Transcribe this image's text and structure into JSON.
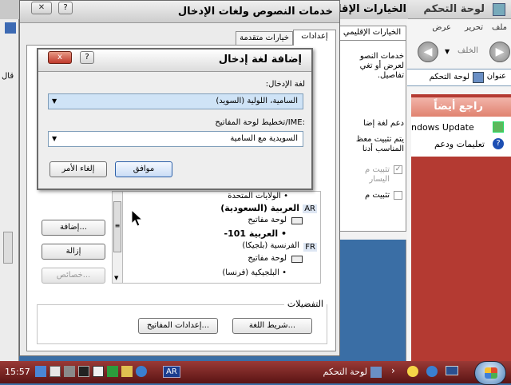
{
  "control_panel": {
    "title": "لوحة التحكم",
    "menu": [
      "ملف",
      "تحرير",
      "عرض"
    ],
    "back_label": "الخلف",
    "address_label": "عنوان",
    "address_value": "لوحة التحكم",
    "see_also_title": "راجع أيضاً",
    "see_also_items": [
      "Windows Update",
      "تعليمات ودعم"
    ],
    "see_also_visible": [
      "ndows Update",
      "تعليمات ودعم"
    ],
    "left_clip": "قال"
  },
  "regional": {
    "title": "الخيارات الإقليمية",
    "tab": "الخيارات الإقليمي",
    "line1": "خدمات النصو",
    "line2": "لعرض أو تغي",
    "line3": "تفاصيل.",
    "lang_support": "دعم لغة إضا",
    "lang_l1": "يتم تثبيت معظ",
    "lang_l2": "المناسب أدنا",
    "chk1a": "تثبيت م",
    "chk1b": "اليسار",
    "chk2": "تثبيت م"
  },
  "text_services": {
    "title": "خدمات النصوص ولغات الإدخال",
    "tabs": [
      "إعدادات",
      "خيارات متقدمة"
    ],
    "tree": {
      "us_layout": "الولايات المتحدة",
      "ar_code": "AR",
      "ar_lang": "العربية (السعودية)",
      "kb1": "لوحة مفاتيح",
      "ar_101": "العربية 101-",
      "fr_code": "FR",
      "fr_lang": "الفرنسية (بلجيكا)",
      "kb2": "لوحة مفاتيح",
      "fr_layout": "البلجيكية (فرنسا)"
    },
    "buttons": {
      "add": "إضافة...",
      "remove": "إزالة",
      "properties": "خصائص..."
    },
    "preferences_label": "التفضيلات",
    "language_bar_button": "شريط اللغة...",
    "key_settings_button": "إعدادات المفاتيح..."
  },
  "add_dialog": {
    "title": "إضافة لغة إدخال",
    "input_language_label": "لغة الإدخال:",
    "input_language_value": "السامية، اللولية (السويد)",
    "keyboard_label": "تخطيط لوحة المفاتيح/IME:",
    "keyboard_value": "السويدية مع السامية",
    "ok": "موافق",
    "cancel": "إلغاء الأمر",
    "help_glyph": "?",
    "close_glyph": "x"
  },
  "taskbar": {
    "clock": "15:57",
    "lang_indicator": "AR",
    "task_label": "لوحة التحكم",
    "task_arrow": "›",
    "tray_icons": [
      "smiley-icon",
      "network-icon",
      "monitor-icon"
    ],
    "quick_icons": [
      "windows-icon",
      "notepad-icon",
      "media-icon",
      "film-icon",
      "chart-icon",
      "paint-icon",
      "folder-icon",
      "network-icon"
    ]
  },
  "colors": {
    "maroon": "#c0392b",
    "start_green": "#3a9b2c",
    "taskbar": "#6e1e1e"
  }
}
